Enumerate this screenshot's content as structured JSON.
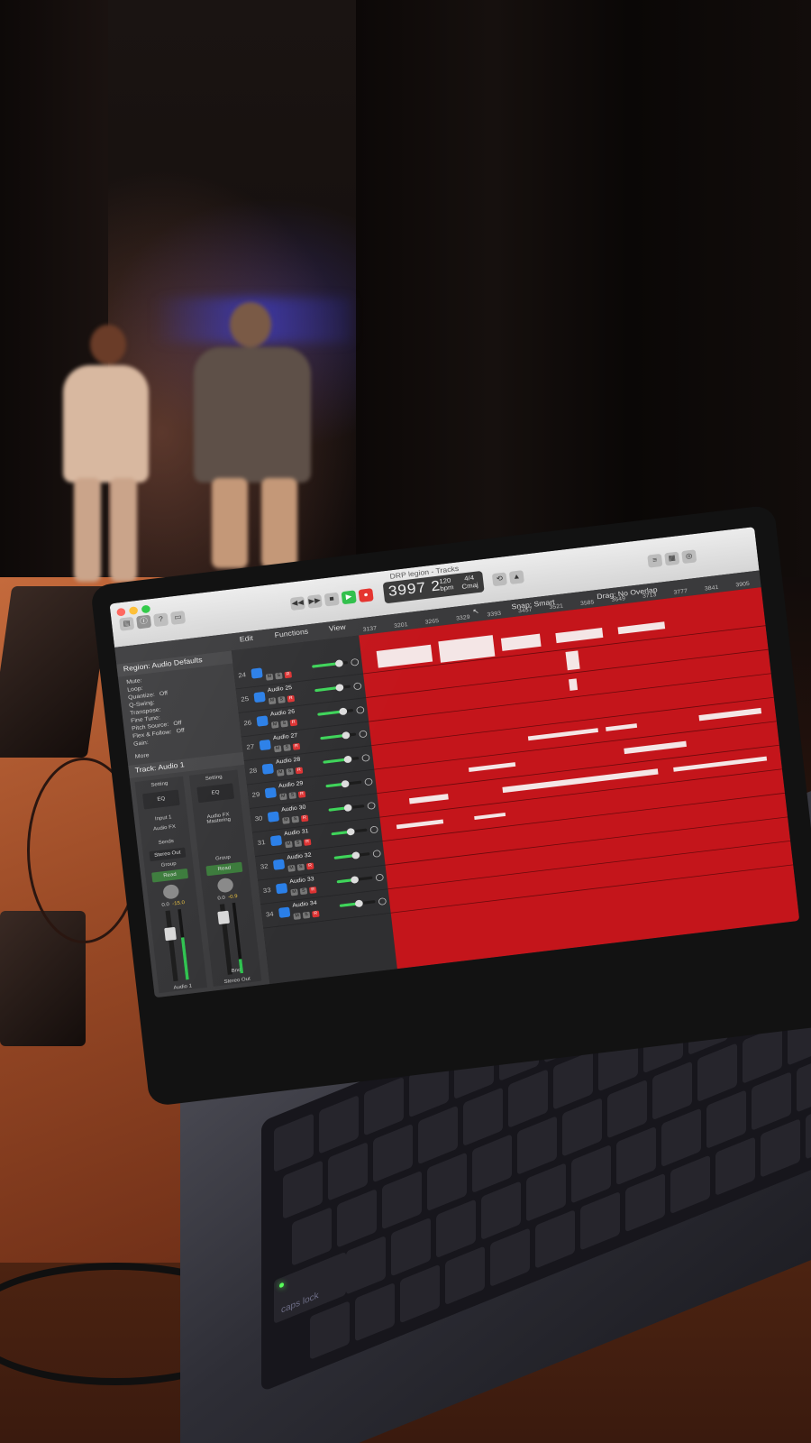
{
  "photo": {
    "description_elements": [
      "stage",
      "performers",
      "laptop"
    ]
  },
  "daw": {
    "window_title": "DRP legion - Tracks",
    "lcd_position": "3997 2",
    "lcd_tempo": "120",
    "lcd_tempo_unit": "bpm",
    "lcd_signature": "4/4",
    "lcd_key": "Cmaj",
    "snap_label": "Snap:",
    "snap_value": "Smart",
    "drag_label": "Drag:",
    "drag_value": "No Overlap",
    "menus": [
      "Edit",
      "Functions",
      "View"
    ],
    "ruler": [
      "3137",
      "3201",
      "3265",
      "3329",
      "3393",
      "3457",
      "3521",
      "3585",
      "3649",
      "3713",
      "3777",
      "3841",
      "3905"
    ],
    "inspector": {
      "region_title": "Region: Audio Defaults",
      "rows": [
        {
          "label": "Mute:"
        },
        {
          "label": "Loop:"
        },
        {
          "label": "Quantize:",
          "value": "Off"
        },
        {
          "label": "Q-Swing:"
        },
        {
          "label": "Transpose:"
        },
        {
          "label": "Fine Tune:"
        },
        {
          "label": "Pitch Source:",
          "value": "Off"
        },
        {
          "label": "Flex & Follow:",
          "value": "Off"
        },
        {
          "label": "Gain:"
        }
      ],
      "more_label": "More",
      "track_title": "Track: Audio 1"
    },
    "strip1": {
      "setting": "Setting",
      "eq": "EQ",
      "input": "Input 1",
      "fx": "Audio FX",
      "sends": "Sends",
      "output": "Stereo Out",
      "group": "Group",
      "automation": "Read",
      "pan": "0.0",
      "level": "-15.0",
      "name": "Audio 1"
    },
    "strip2": {
      "setting": "Setting",
      "eq": "EQ",
      "fx": "Audio FX Mastering",
      "group": "Group",
      "automation": "Read",
      "pan": "0.0",
      "level": "-0.9",
      "bnc": "Bnc",
      "name": "Stereo Out"
    },
    "tracks": [
      {
        "num": "24",
        "name": "",
        "vol": 0.75
      },
      {
        "num": "25",
        "name": "Audio 25",
        "vol": 0.7
      },
      {
        "num": "26",
        "name": "Audio 26",
        "vol": 0.72
      },
      {
        "num": "27",
        "name": "Audio 27",
        "vol": 0.72
      },
      {
        "num": "28",
        "name": "Audio 28",
        "vol": 0.7
      },
      {
        "num": "29",
        "name": "Audio 29",
        "vol": 0.55
      },
      {
        "num": "30",
        "name": "Audio 30",
        "vol": 0.55
      },
      {
        "num": "31",
        "name": "Audio 31",
        "vol": 0.55
      },
      {
        "num": "32",
        "name": "Audio 32",
        "vol": 0.6
      },
      {
        "num": "33",
        "name": "Audio 33",
        "vol": 0.5
      },
      {
        "num": "34",
        "name": "Audio 34",
        "vol": 0.55
      }
    ],
    "colors": {
      "region": "#c4151b",
      "track_icon": "#2a7fe8",
      "volume": "#3fd45a"
    }
  },
  "keyboard": {
    "caps_lock_label": "caps lock"
  }
}
